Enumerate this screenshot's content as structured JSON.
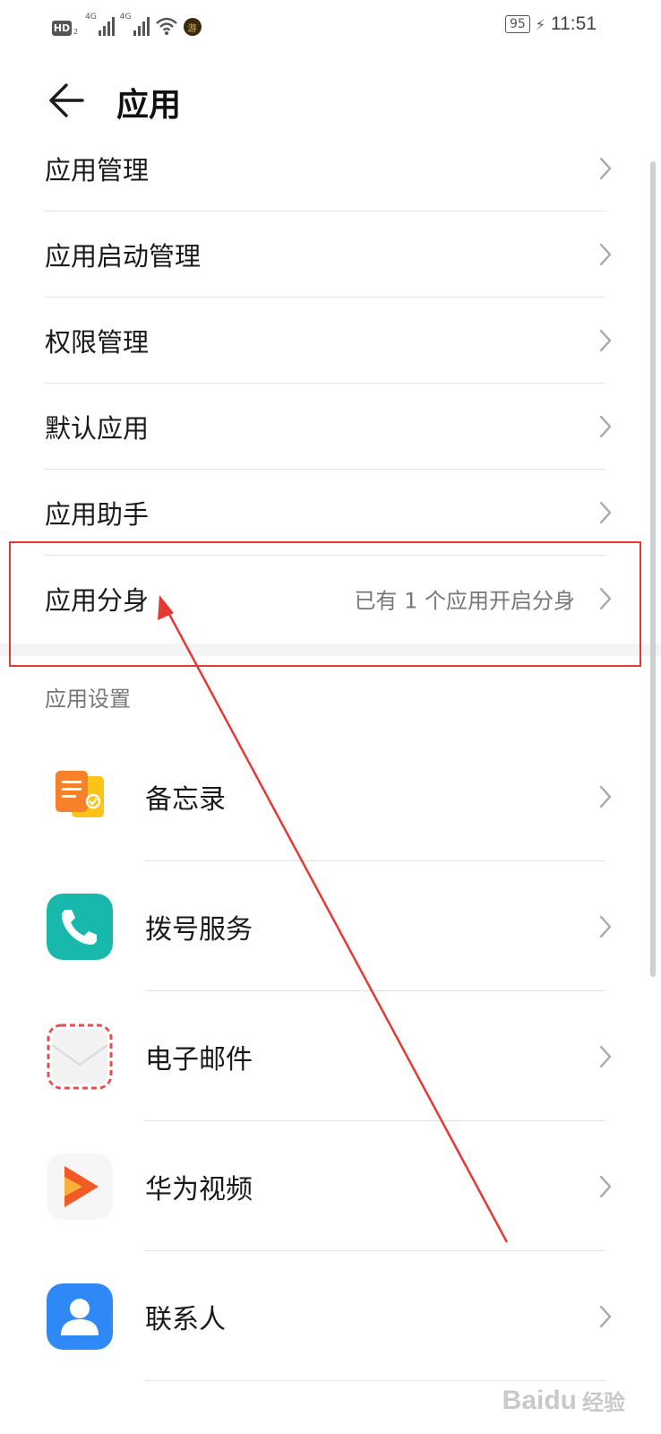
{
  "status_bar": {
    "hd_label": "HD",
    "hd_sub": "2",
    "net1_label": "4G",
    "net2_label": "4G",
    "app_icon_glyph": "游",
    "battery": "95",
    "time": "11:51"
  },
  "header": {
    "title": "应用"
  },
  "menu": {
    "items": [
      {
        "label": "应用管理",
        "value": ""
      },
      {
        "label": "应用启动管理",
        "value": ""
      },
      {
        "label": "权限管理",
        "value": ""
      },
      {
        "label": "默认应用",
        "value": ""
      },
      {
        "label": "应用助手",
        "value": ""
      },
      {
        "label": "应用分身",
        "value": "已有 1 个应用开启分身"
      }
    ]
  },
  "section": {
    "title": "应用设置"
  },
  "apps": [
    {
      "name": "备忘录",
      "icon": "notepad-icon",
      "color": "#f7a02a"
    },
    {
      "name": "拨号服务",
      "icon": "phone-icon",
      "color": "#19b8ac"
    },
    {
      "name": "电子邮件",
      "icon": "mail-icon",
      "color": "#e84c4c"
    },
    {
      "name": "华为视频",
      "icon": "video-play-icon",
      "color": "#f15a24"
    },
    {
      "name": "联系人",
      "icon": "contact-icon",
      "color": "#2e88f5"
    }
  ],
  "annotation": {
    "color": "#e53935"
  },
  "watermark": {
    "brand": "Baidu",
    "suffix": "经验"
  }
}
